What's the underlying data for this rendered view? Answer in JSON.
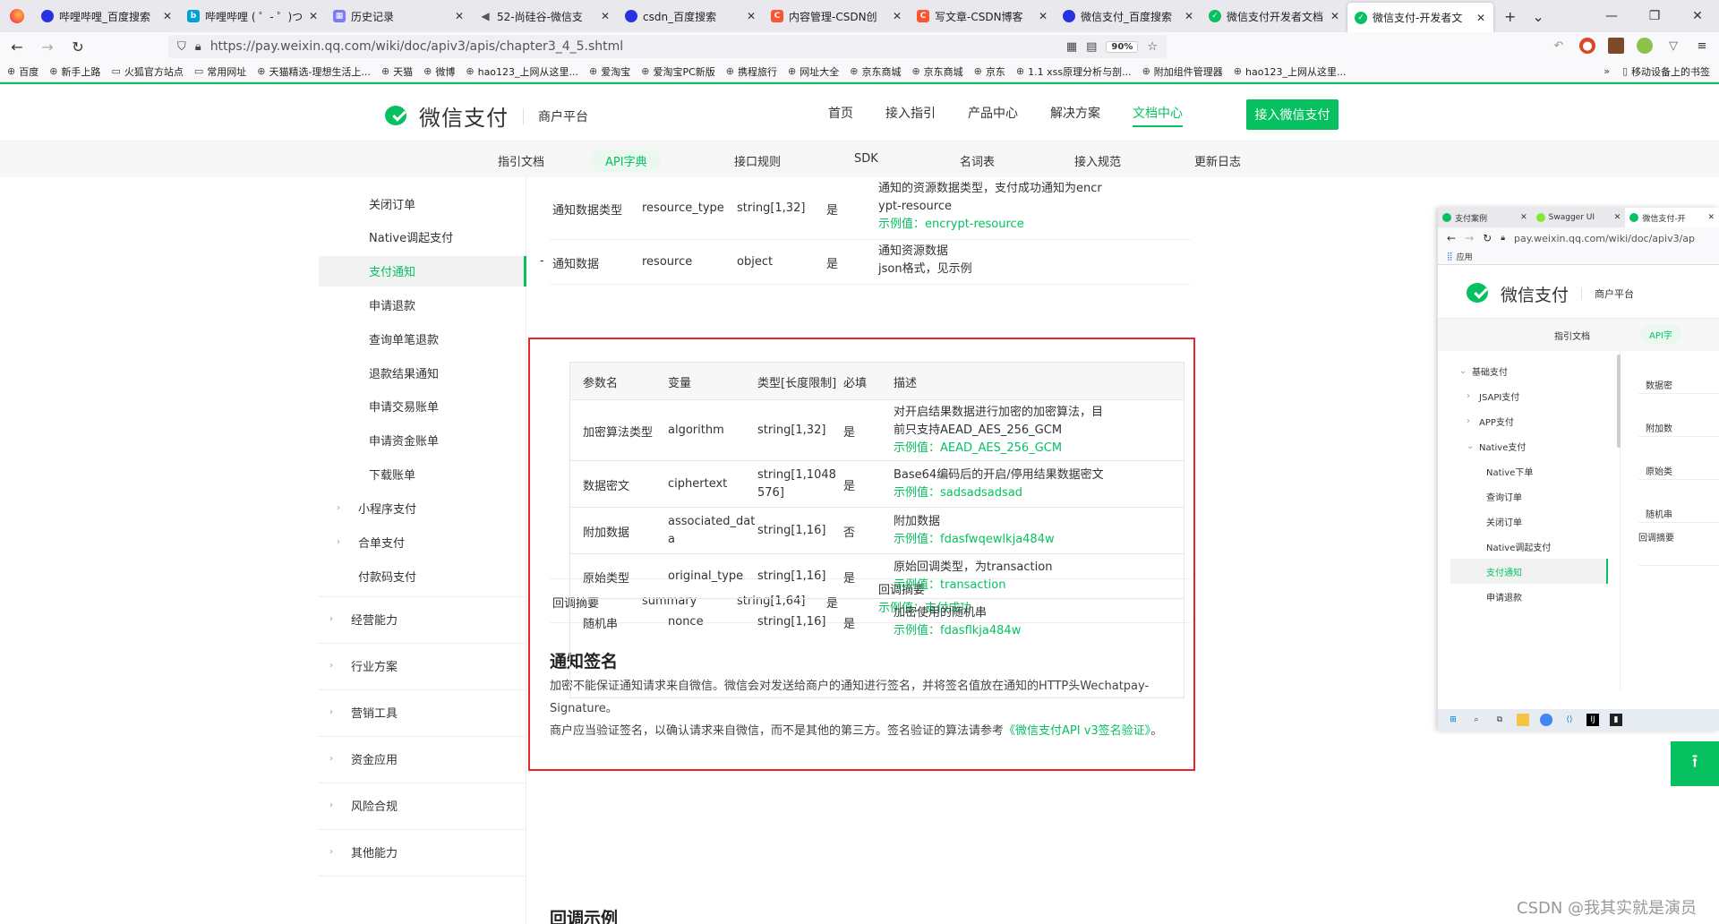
{
  "browser": {
    "tabs": [
      {
        "label": "哔哩哔哩_百度搜索",
        "icon": "baidu"
      },
      {
        "label": "哔哩哔哩 ( ゜- ゜)つ",
        "icon": "bili"
      },
      {
        "label": "历史记录",
        "icon": "hist"
      },
      {
        "label": "52-尚硅谷-微信支",
        "icon": "sound"
      },
      {
        "label": "csdn_百度搜索",
        "icon": "baidu"
      },
      {
        "label": "内容管理-CSDN创",
        "icon": "csdn"
      },
      {
        "label": "写文章-CSDN博客",
        "icon": "csdn"
      },
      {
        "label": "微信支付_百度搜索",
        "icon": "baidu"
      },
      {
        "label": "微信支付开发者文档",
        "icon": "wx"
      },
      {
        "label": "微信支付-开发者文",
        "icon": "wx",
        "active": true
      }
    ],
    "url": "https://pay.weixin.qq.com/wiki/doc/apiv3/apis/chapter3_4_5.shtml",
    "zoom": "90%",
    "bookmarks": [
      "百度",
      "新手上路",
      "火狐官方站点",
      "常用网址",
      "天猫精选-理想生活上...",
      "天猫",
      "微博",
      "hao123_上网从这里...",
      "爱淘宝",
      "爱淘宝PC新版",
      "携程旅行",
      "网址大全",
      "京东商城",
      "京东商城",
      "京东",
      "1.1 xss原理分析与剖...",
      "附加组件管理器",
      "hao123_上网从这里..."
    ],
    "bookmarks_mobile": "移动设备上的书签"
  },
  "site": {
    "logo_text": "微信支付",
    "logo_sub": "商户平台",
    "nav": [
      "首页",
      "接入指引",
      "产品中心",
      "解决方案",
      "文档中心"
    ],
    "nav_active": "文档中心",
    "join_button": "接入微信支付",
    "subnav": [
      "指引文档",
      "API字典",
      "接口规则",
      "SDK",
      "名词表",
      "接入规范",
      "更新日志"
    ],
    "subnav_active": "API字典"
  },
  "sidebar": {
    "sub_items": [
      "关闭订单",
      "Native调起支付",
      "支付通知",
      "申请退款",
      "查询单笔退款",
      "退款结果通知",
      "申请交易账单",
      "申请资金账单",
      "下载账单"
    ],
    "active": "支付通知",
    "groups": [
      "小程序支付",
      "合单支付",
      "付款码支付"
    ],
    "sections": [
      "经营能力",
      "行业方案",
      "营销工具",
      "资金应用",
      "风险合规",
      "其他能力"
    ]
  },
  "table": {
    "example_prefix": "示例值：",
    "rows_top": [
      {
        "name": "通知数据类型",
        "var": "resource_type",
        "type": "string[1,32]",
        "required": "是",
        "desc": [
          "通知的资源数据类型，支付成功通知为encr",
          "ypt-resource"
        ],
        "example": "encrypt-resource"
      },
      {
        "name": "通知数据",
        "var": "resource",
        "type": "object",
        "required": "是",
        "desc": [
          "通知资源数据",
          "json格式，见示例"
        ],
        "toggle": "-"
      }
    ],
    "inner_header": [
      "参数名",
      "变量",
      "类型[长度限制]",
      "必填",
      "描述"
    ],
    "inner_rows": [
      {
        "name": "加密算法类型",
        "var": "algorithm",
        "type": [
          "string[1,32]"
        ],
        "required": "是",
        "desc": [
          "对开启结果数据进行加密的加密算法，目",
          "前只支持AEAD_AES_256_GCM"
        ],
        "example": "AEAD_AES_256_GCM"
      },
      {
        "name": "数据密文",
        "var": "ciphertext",
        "type": [
          "string[1,1048",
          "576]"
        ],
        "required": "是",
        "desc": [
          "Base64编码后的开启/停用结果数据密文"
        ],
        "example": "sadsadsadsad"
      },
      {
        "name": "附加数据",
        "var": [
          "associated_dat",
          "a"
        ],
        "type": [
          "string[1,16]"
        ],
        "required": "否",
        "desc": [
          "附加数据"
        ],
        "example": "fdasfwqewlkja484w"
      },
      {
        "name": "原始类型",
        "var": "original_type",
        "type": [
          "string[1,16]"
        ],
        "required": "是",
        "desc": [
          "原始回调类型，为transaction"
        ],
        "example": "transaction"
      },
      {
        "name": "随机串",
        "var": "nonce",
        "type": [
          "string[1,16]"
        ],
        "required": "是",
        "desc": [
          "加密使用的随机串"
        ],
        "example": "fdasflkja484w"
      }
    ],
    "row_bottom": {
      "name": "回调摘要",
      "var": "summary",
      "type": "string[1,64]",
      "required": "是",
      "desc": [
        "回调摘要"
      ],
      "example": "支付成功"
    }
  },
  "section_sign": {
    "title": "通知签名",
    "para1": "加密不能保证通知请求来自微信。微信会对发送给商户的通知进行签名，并将签名值放在通知的HTTP头Wechatpay-Signature。",
    "para2_pre": "商户应当验证签名，以确认请求来自微信，而不是其他的第三方。签名验证的算法请参考",
    "para2_link": "《微信支付API v3签名验证》",
    "para2_post": "。"
  },
  "section_example": {
    "title": "回调示例"
  },
  "mini_window": {
    "tabs": [
      "支付案例",
      "Swagger UI",
      "微信支付-开"
    ],
    "url": "pay.weixin.qq.com/wiki/doc/apiv3/ap",
    "bookmark": "应用",
    "logo_text": "微信支付",
    "logo_sub": "商户平台",
    "subnav": [
      "指引文档",
      "API字"
    ],
    "side_items": [
      "基础支付",
      "JSAPI支付",
      "APP支付",
      "Native支付",
      "Native下单",
      "查询订单",
      "关闭订单",
      "Native调起支付",
      "支付通知",
      "申请退款"
    ],
    "side_active": "支付通知",
    "col_items": [
      "数据密",
      "附加数",
      "原始类",
      "随机串",
      "回调摘要"
    ]
  },
  "watermark": "CSDN @我其实就是演员"
}
